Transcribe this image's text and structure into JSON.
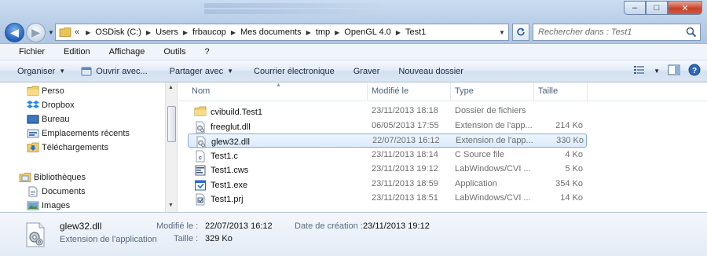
{
  "window": {
    "minimize": "–",
    "maximize": "□",
    "close": "✕"
  },
  "address": {
    "crumbs": [
      "OSDisk (C:)",
      "Users",
      "frbaucop",
      "Mes documents",
      "tmp",
      "OpenGL 4.0",
      "Test1"
    ],
    "overflow": "«"
  },
  "search": {
    "placeholder": "Rechercher dans : Test1"
  },
  "menu": [
    "Fichier",
    "Edition",
    "Affichage",
    "Outils",
    "?"
  ],
  "commands": {
    "organize": "Organiser",
    "open_with": "Ouvrir avec...",
    "share_with": "Partager avec",
    "email": "Courrier électronique",
    "burn": "Graver",
    "new_folder": "Nouveau dossier"
  },
  "nav": {
    "items": [
      {
        "label": "Perso",
        "icon": "folder-icon"
      },
      {
        "label": "Dropbox",
        "icon": "dropbox-icon"
      },
      {
        "label": "Bureau",
        "icon": "desktop-icon"
      },
      {
        "label": "Emplacements récents",
        "icon": "recent-places-icon"
      },
      {
        "label": "Téléchargements",
        "icon": "downloads-icon"
      },
      {
        "label": "Bibliothèques",
        "icon": "libraries-icon"
      },
      {
        "label": "Documents",
        "icon": "documents-icon"
      },
      {
        "label": "Images",
        "icon": "images-icon"
      }
    ]
  },
  "columns": {
    "name": "Nom",
    "date": "Modifié le",
    "type": "Type",
    "size": "Taille"
  },
  "files": [
    {
      "name": "cvibuild.Test1",
      "date": "23/11/2013 18:18",
      "type": "Dossier de fichiers",
      "size": "",
      "icon": "folder-icon"
    },
    {
      "name": "freeglut.dll",
      "date": "06/05/2013 17:55",
      "type": "Extension de l'app...",
      "size": "214 Ko",
      "icon": "dll-icon"
    },
    {
      "name": "glew32.dll",
      "date": "22/07/2013 16:12",
      "type": "Extension de l'app...",
      "size": "330 Ko",
      "icon": "dll-icon",
      "selected": true
    },
    {
      "name": "Test1.c",
      "date": "23/11/2013 18:14",
      "type": "C Source file",
      "size": "4 Ko",
      "icon": "c-source-icon"
    },
    {
      "name": "Test1.cws",
      "date": "23/11/2013 19:12",
      "type": "LabWindows/CVI ...",
      "size": "5 Ko",
      "icon": "cws-icon"
    },
    {
      "name": "Test1.exe",
      "date": "23/11/2013 18:59",
      "type": "Application",
      "size": "354 Ko",
      "icon": "exe-icon"
    },
    {
      "name": "Test1.prj",
      "date": "23/11/2013 18:51",
      "type": "LabWindows/CVI ...",
      "size": "14 Ko",
      "icon": "prj-icon"
    }
  ],
  "details": {
    "name": "glew32.dll",
    "type": "Extension de l'application",
    "modified_label": "Modifié le :",
    "modified_value": "22/07/2013 16:12",
    "size_label": "Taille :",
    "size_value": "329 Ko",
    "created_label": "Date de création :",
    "created_value": "23/11/2013 19:12"
  }
}
